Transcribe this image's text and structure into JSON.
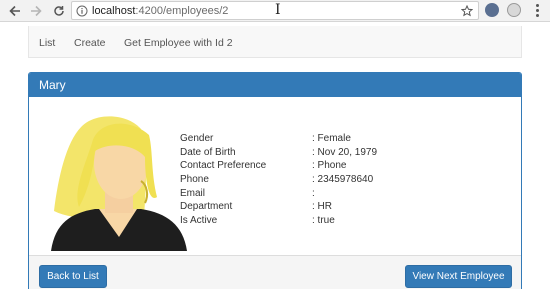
{
  "browser": {
    "url_host": "localhost",
    "url_path": ":4200/employees/2",
    "icons": [
      "back-icon",
      "forward-icon",
      "reload-icon",
      "info-icon",
      "star-icon",
      "extension-icon",
      "menu-icon"
    ]
  },
  "navbar": {
    "items": [
      "List",
      "Create",
      "Get Employee with Id 2"
    ]
  },
  "employee": {
    "name": "Mary",
    "fields": [
      {
        "label": "Gender",
        "value": ": Female"
      },
      {
        "label": "Date of Birth",
        "value": ": Nov 20, 1979"
      },
      {
        "label": "Contact Preference",
        "value": ": Phone"
      },
      {
        "label": "Phone",
        "value": ": 2345978640"
      },
      {
        "label": "Email",
        "value": ":"
      },
      {
        "label": "Department",
        "value": ": HR"
      },
      {
        "label": "Is Active",
        "value": ": true"
      }
    ]
  },
  "footer": {
    "back_label": "Back to List",
    "next_label": "View Next Employee"
  },
  "colors": {
    "primary": "#337ab7",
    "panel_footer": "#f5f5f5",
    "navbar_bg": "#f8f8f8"
  }
}
